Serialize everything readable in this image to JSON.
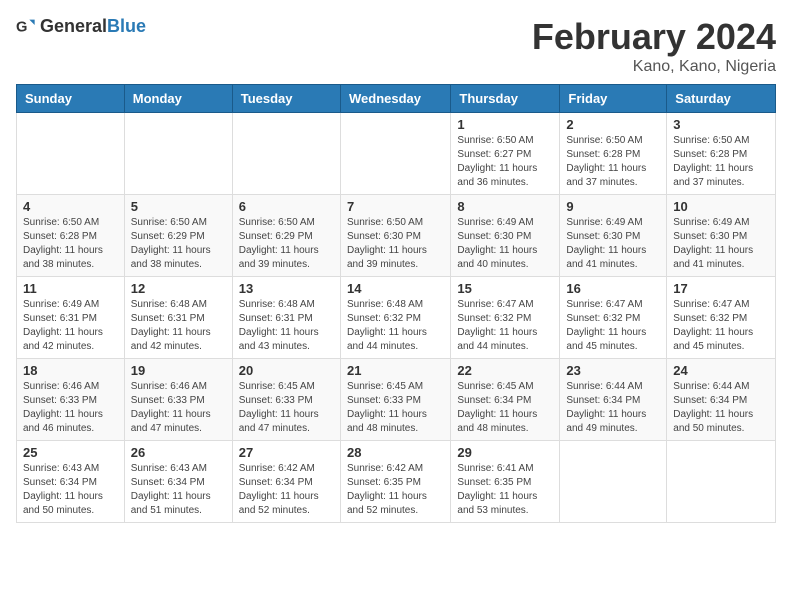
{
  "header": {
    "logo_general": "General",
    "logo_blue": "Blue",
    "month_year": "February 2024",
    "location": "Kano, Kano, Nigeria"
  },
  "days_of_week": [
    "Sunday",
    "Monday",
    "Tuesday",
    "Wednesday",
    "Thursday",
    "Friday",
    "Saturday"
  ],
  "weeks": [
    [
      {
        "day": "",
        "info": ""
      },
      {
        "day": "",
        "info": ""
      },
      {
        "day": "",
        "info": ""
      },
      {
        "day": "",
        "info": ""
      },
      {
        "day": "1",
        "info": "Sunrise: 6:50 AM\nSunset: 6:27 PM\nDaylight: 11 hours and 36 minutes."
      },
      {
        "day": "2",
        "info": "Sunrise: 6:50 AM\nSunset: 6:28 PM\nDaylight: 11 hours and 37 minutes."
      },
      {
        "day": "3",
        "info": "Sunrise: 6:50 AM\nSunset: 6:28 PM\nDaylight: 11 hours and 37 minutes."
      }
    ],
    [
      {
        "day": "4",
        "info": "Sunrise: 6:50 AM\nSunset: 6:28 PM\nDaylight: 11 hours and 38 minutes."
      },
      {
        "day": "5",
        "info": "Sunrise: 6:50 AM\nSunset: 6:29 PM\nDaylight: 11 hours and 38 minutes."
      },
      {
        "day": "6",
        "info": "Sunrise: 6:50 AM\nSunset: 6:29 PM\nDaylight: 11 hours and 39 minutes."
      },
      {
        "day": "7",
        "info": "Sunrise: 6:50 AM\nSunset: 6:30 PM\nDaylight: 11 hours and 39 minutes."
      },
      {
        "day": "8",
        "info": "Sunrise: 6:49 AM\nSunset: 6:30 PM\nDaylight: 11 hours and 40 minutes."
      },
      {
        "day": "9",
        "info": "Sunrise: 6:49 AM\nSunset: 6:30 PM\nDaylight: 11 hours and 41 minutes."
      },
      {
        "day": "10",
        "info": "Sunrise: 6:49 AM\nSunset: 6:30 PM\nDaylight: 11 hours and 41 minutes."
      }
    ],
    [
      {
        "day": "11",
        "info": "Sunrise: 6:49 AM\nSunset: 6:31 PM\nDaylight: 11 hours and 42 minutes."
      },
      {
        "day": "12",
        "info": "Sunrise: 6:48 AM\nSunset: 6:31 PM\nDaylight: 11 hours and 42 minutes."
      },
      {
        "day": "13",
        "info": "Sunrise: 6:48 AM\nSunset: 6:31 PM\nDaylight: 11 hours and 43 minutes."
      },
      {
        "day": "14",
        "info": "Sunrise: 6:48 AM\nSunset: 6:32 PM\nDaylight: 11 hours and 44 minutes."
      },
      {
        "day": "15",
        "info": "Sunrise: 6:47 AM\nSunset: 6:32 PM\nDaylight: 11 hours and 44 minutes."
      },
      {
        "day": "16",
        "info": "Sunrise: 6:47 AM\nSunset: 6:32 PM\nDaylight: 11 hours and 45 minutes."
      },
      {
        "day": "17",
        "info": "Sunrise: 6:47 AM\nSunset: 6:32 PM\nDaylight: 11 hours and 45 minutes."
      }
    ],
    [
      {
        "day": "18",
        "info": "Sunrise: 6:46 AM\nSunset: 6:33 PM\nDaylight: 11 hours and 46 minutes."
      },
      {
        "day": "19",
        "info": "Sunrise: 6:46 AM\nSunset: 6:33 PM\nDaylight: 11 hours and 47 minutes."
      },
      {
        "day": "20",
        "info": "Sunrise: 6:45 AM\nSunset: 6:33 PM\nDaylight: 11 hours and 47 minutes."
      },
      {
        "day": "21",
        "info": "Sunrise: 6:45 AM\nSunset: 6:33 PM\nDaylight: 11 hours and 48 minutes."
      },
      {
        "day": "22",
        "info": "Sunrise: 6:45 AM\nSunset: 6:34 PM\nDaylight: 11 hours and 48 minutes."
      },
      {
        "day": "23",
        "info": "Sunrise: 6:44 AM\nSunset: 6:34 PM\nDaylight: 11 hours and 49 minutes."
      },
      {
        "day": "24",
        "info": "Sunrise: 6:44 AM\nSunset: 6:34 PM\nDaylight: 11 hours and 50 minutes."
      }
    ],
    [
      {
        "day": "25",
        "info": "Sunrise: 6:43 AM\nSunset: 6:34 PM\nDaylight: 11 hours and 50 minutes."
      },
      {
        "day": "26",
        "info": "Sunrise: 6:43 AM\nSunset: 6:34 PM\nDaylight: 11 hours and 51 minutes."
      },
      {
        "day": "27",
        "info": "Sunrise: 6:42 AM\nSunset: 6:34 PM\nDaylight: 11 hours and 52 minutes."
      },
      {
        "day": "28",
        "info": "Sunrise: 6:42 AM\nSunset: 6:35 PM\nDaylight: 11 hours and 52 minutes."
      },
      {
        "day": "29",
        "info": "Sunrise: 6:41 AM\nSunset: 6:35 PM\nDaylight: 11 hours and 53 minutes."
      },
      {
        "day": "",
        "info": ""
      },
      {
        "day": "",
        "info": ""
      }
    ]
  ]
}
